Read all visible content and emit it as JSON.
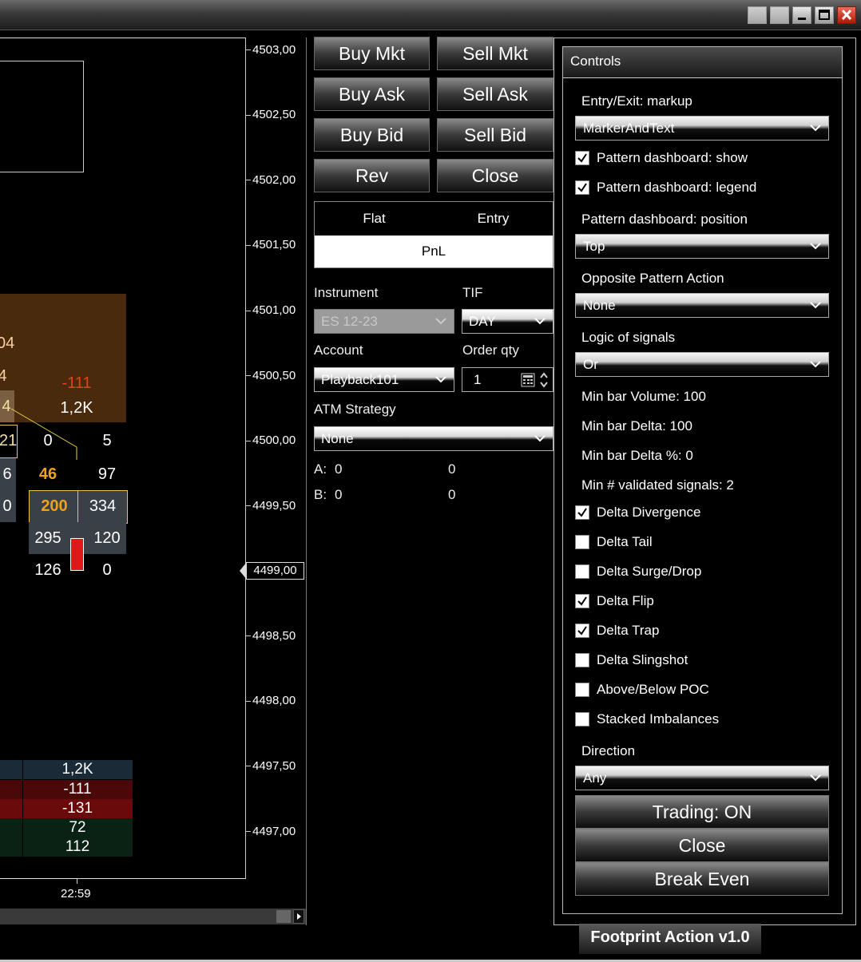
{
  "chart": {
    "price_labels": [
      "4503,00",
      "4502,50",
      "4502,00",
      "4501,50",
      "4501,00",
      "4500,50",
      "4500,00",
      "4499,50",
      "4499,00",
      "4498,50",
      "4498,00",
      "4497,50",
      "4497,00"
    ],
    "current_price": "4499,00",
    "time_label": "22:59",
    "footprint": {
      "left_04": "04",
      "left_4a": "4",
      "left_4b": "4",
      "left_21": "21",
      "left_6": "6",
      "left_0": "0",
      "delta": "-111",
      "volume": "1,2K",
      "r1_bid": "0",
      "r1_ask": "5",
      "r2_bid": "46",
      "r2_ask": "97",
      "r3_bid": "200",
      "r3_ask": "334",
      "r4_bid": "295",
      "r4_ask": "120",
      "r5_bid": "126",
      "r5_ask": "0"
    },
    "stats": [
      "1,2K",
      "-111",
      "-131",
      "72",
      "112"
    ]
  },
  "orders": {
    "buy_mkt": "Buy Mkt",
    "sell_mkt": "Sell Mkt",
    "buy_ask": "Buy Ask",
    "sell_ask": "Sell Ask",
    "buy_bid": "Buy Bid",
    "sell_bid": "Sell Bid",
    "rev": "Rev",
    "close": "Close",
    "flat": "Flat",
    "entry": "Entry",
    "pnl": "PnL",
    "instrument_label": "Instrument",
    "instrument": "ES 12-23",
    "tif_label": "TIF",
    "tif": "DAY",
    "account_label": "Account",
    "account": "Playback101",
    "qty_label": "Order qty",
    "qty": "1",
    "atm_label": "ATM Strategy",
    "atm": "None",
    "a_label": "A:",
    "a_val1": "0",
    "a_val2": "0",
    "b_label": "B:",
    "b_val1": "0",
    "b_val2": "0"
  },
  "controls": {
    "title": "Controls",
    "entry_exit_label": "Entry/Exit: markup",
    "entry_exit": "MarkerAndText",
    "dash_show": "Pattern dashboard: show",
    "dash_legend": "Pattern dashboard: legend",
    "dash_pos_label": "Pattern dashboard: position",
    "dash_pos": "Top",
    "opp_label": "Opposite Pattern Action",
    "opp": "None",
    "logic_label": "Logic of signals",
    "logic": "Or",
    "min_vol": "Min bar Volume: 100",
    "min_delta": "Min bar Delta: 100",
    "min_delta_pct": "Min bar Delta %: 0",
    "min_signals": "Min # validated signals: 2",
    "signals": [
      {
        "label": "Delta Divergence",
        "checked": true
      },
      {
        "label": "Delta Tail",
        "checked": false
      },
      {
        "label": "Delta Surge/Drop",
        "checked": false
      },
      {
        "label": "Delta Flip",
        "checked": true
      },
      {
        "label": "Delta Trap",
        "checked": true
      },
      {
        "label": "Delta Slingshot",
        "checked": false
      },
      {
        "label": "Above/Below POC",
        "checked": false
      },
      {
        "label": "Stacked Imbalances",
        "checked": false
      }
    ],
    "direction_label": "Direction",
    "direction": "Any",
    "trading": "Trading: ON",
    "close": "Close",
    "break_even": "Break Even"
  },
  "footer": "Footprint Action v1.0",
  "colors": {
    "delta_negative": "#e8401c",
    "highlight_orange": "#f0a020",
    "footprint_bg": "#4a2a0c",
    "stat_volume_bg": "#1a2a36",
    "stat_neg_bg": "#5a0a0a",
    "stat_neg_strong_bg": "#8a0c0c",
    "stat_pos_bg": "#0a2a16"
  }
}
